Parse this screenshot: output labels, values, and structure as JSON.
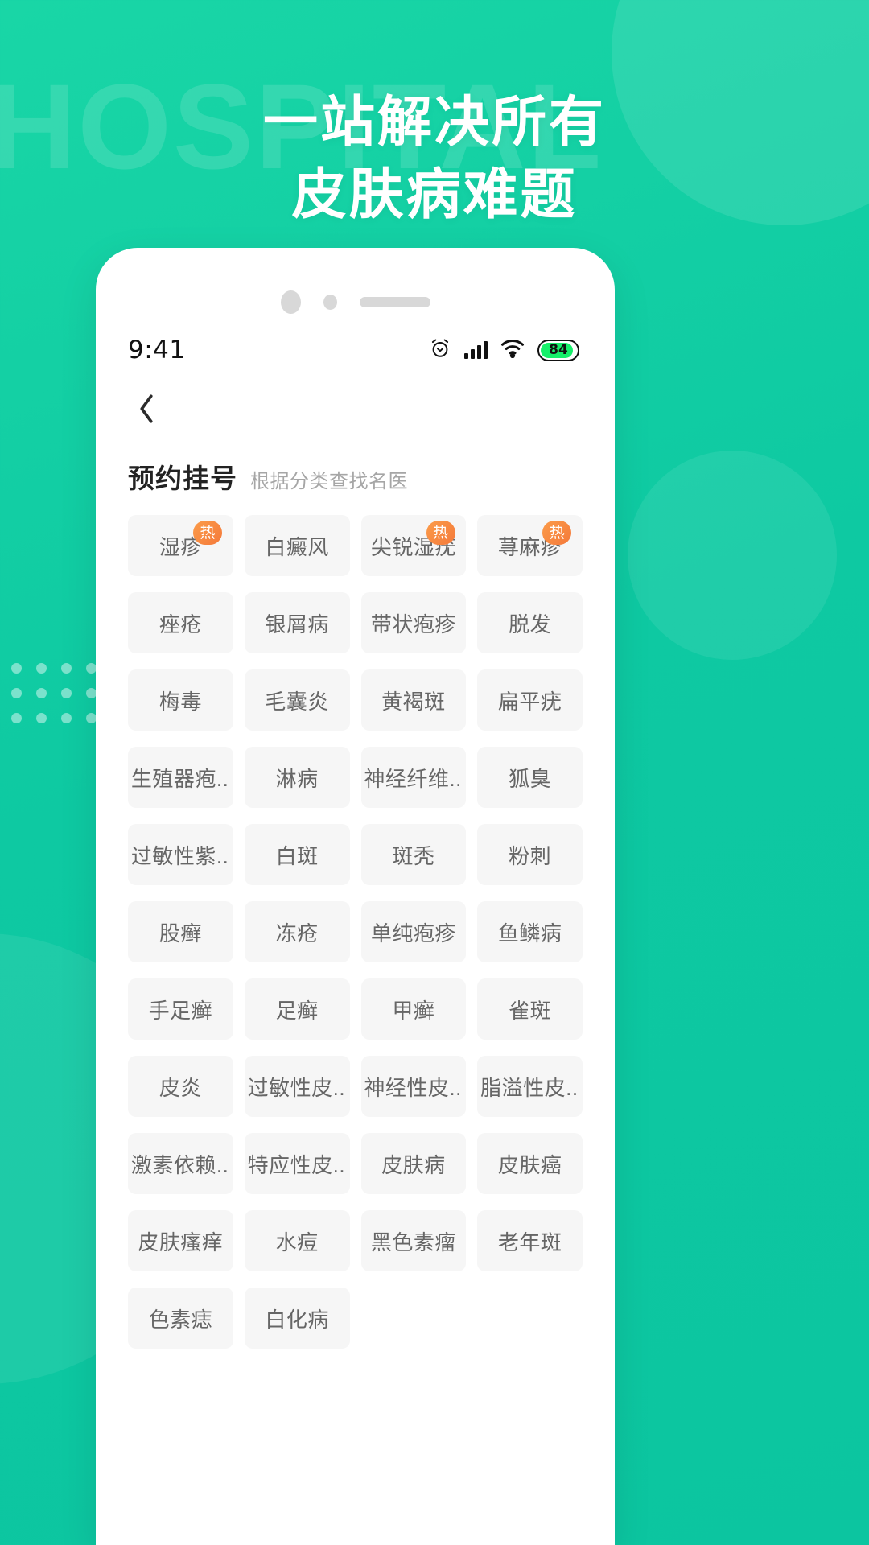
{
  "promo": {
    "watermark": "HOSPITAL",
    "headline_line1": "一站解决所有",
    "headline_line2": "皮肤病难题",
    "brand_color": "#0ec9a2",
    "accent_color": "#f4793a"
  },
  "status_bar": {
    "time": "9:41",
    "battery_level": "84",
    "icons": [
      "alarm-icon",
      "signal-icon",
      "wifi-icon",
      "battery-icon"
    ]
  },
  "nav": {
    "back_icon": "chevron-left-icon"
  },
  "section": {
    "title": "预约挂号",
    "subtitle": "根据分类查找名医"
  },
  "chips": [
    {
      "label": "湿疹",
      "badge": "热"
    },
    {
      "label": "白癜风",
      "badge": ""
    },
    {
      "label": "尖锐湿疣",
      "badge": "热"
    },
    {
      "label": "荨麻疹",
      "badge": "热"
    },
    {
      "label": "痤疮",
      "badge": ""
    },
    {
      "label": "银屑病",
      "badge": ""
    },
    {
      "label": "带状疱疹",
      "badge": ""
    },
    {
      "label": "脱发",
      "badge": ""
    },
    {
      "label": "梅毒",
      "badge": ""
    },
    {
      "label": "毛囊炎",
      "badge": ""
    },
    {
      "label": "黄褐斑",
      "badge": ""
    },
    {
      "label": "扁平疣",
      "badge": ""
    },
    {
      "label": "生殖器疱...",
      "badge": ""
    },
    {
      "label": "淋病",
      "badge": ""
    },
    {
      "label": "神经纤维...",
      "badge": ""
    },
    {
      "label": "狐臭",
      "badge": ""
    },
    {
      "label": "过敏性紫...",
      "badge": ""
    },
    {
      "label": "白斑",
      "badge": ""
    },
    {
      "label": "斑秃",
      "badge": ""
    },
    {
      "label": "粉刺",
      "badge": ""
    },
    {
      "label": "股癣",
      "badge": ""
    },
    {
      "label": "冻疮",
      "badge": ""
    },
    {
      "label": "单纯疱疹",
      "badge": ""
    },
    {
      "label": "鱼鳞病",
      "badge": ""
    },
    {
      "label": "手足癣",
      "badge": ""
    },
    {
      "label": "足癣",
      "badge": ""
    },
    {
      "label": "甲癣",
      "badge": ""
    },
    {
      "label": "雀斑",
      "badge": ""
    },
    {
      "label": "皮炎",
      "badge": ""
    },
    {
      "label": "过敏性皮...",
      "badge": ""
    },
    {
      "label": "神经性皮...",
      "badge": ""
    },
    {
      "label": "脂溢性皮...",
      "badge": ""
    },
    {
      "label": "激素依赖...",
      "badge": ""
    },
    {
      "label": "特应性皮...",
      "badge": ""
    },
    {
      "label": "皮肤病",
      "badge": ""
    },
    {
      "label": "皮肤癌",
      "badge": ""
    },
    {
      "label": "皮肤瘙痒",
      "badge": ""
    },
    {
      "label": "水痘",
      "badge": ""
    },
    {
      "label": "黑色素瘤",
      "badge": ""
    },
    {
      "label": "老年斑",
      "badge": ""
    },
    {
      "label": "色素痣",
      "badge": ""
    },
    {
      "label": "白化病",
      "badge": ""
    }
  ]
}
